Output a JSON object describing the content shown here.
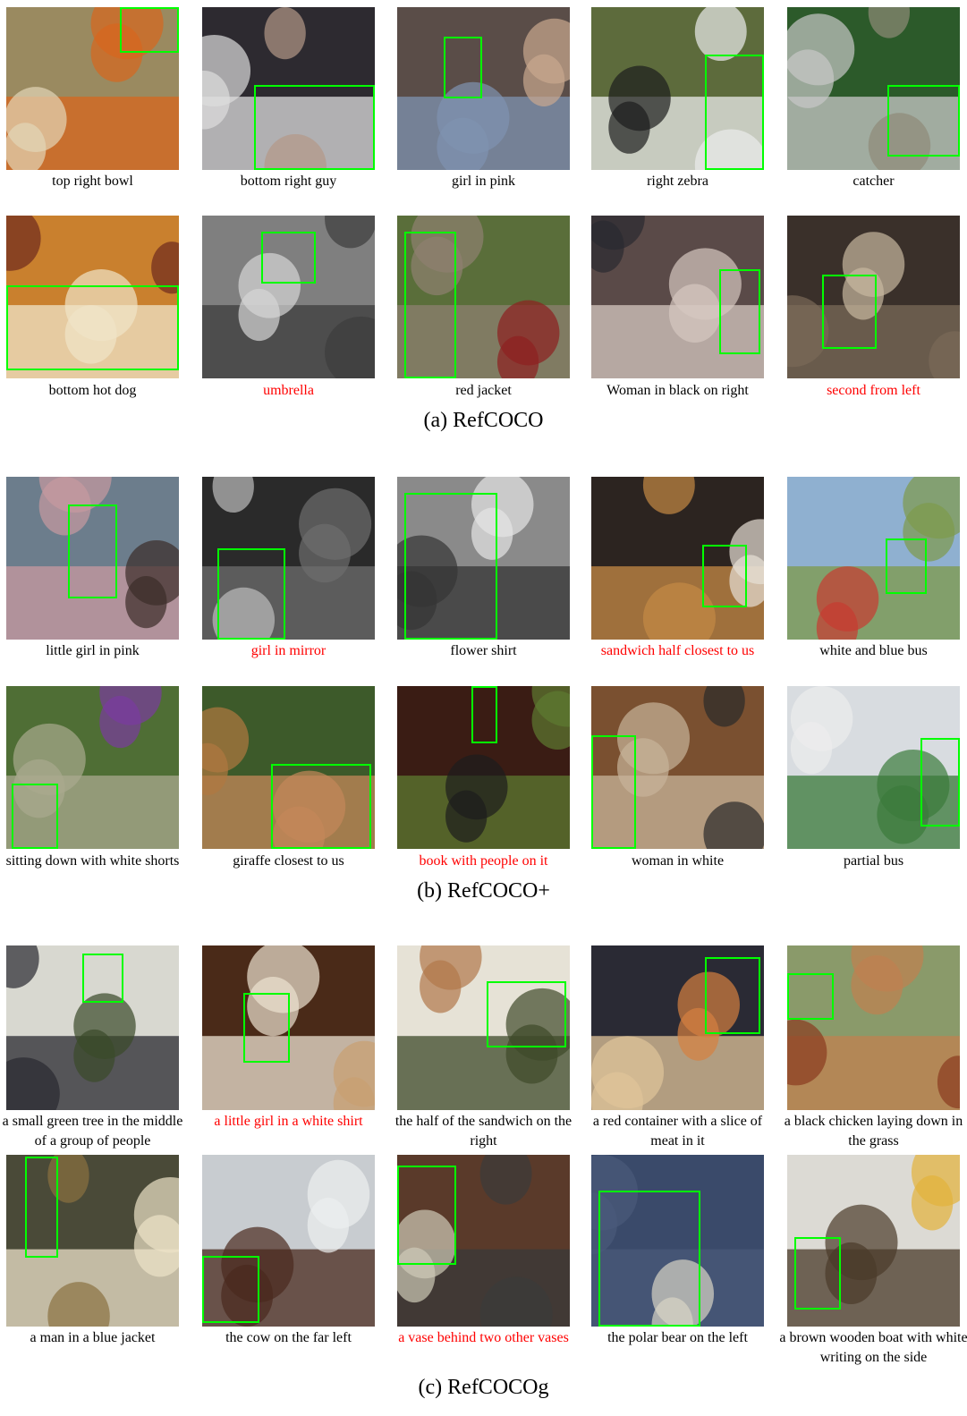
{
  "sections": [
    {
      "title": "(a) RefCOCO",
      "items": [
        {
          "caption": "top right bowl",
          "red": false,
          "palette": [
            "#9a8a60",
            "#e3d6b8",
            "#d7661e"
          ],
          "box": {
            "l": 0.66,
            "t": 0.0,
            "w": 0.34,
            "h": 0.28
          }
        },
        {
          "caption": "bottom right guy",
          "red": false,
          "palette": [
            "#2d2a30",
            "#b49888",
            "#dddddd"
          ],
          "box": {
            "l": 0.3,
            "t": 0.48,
            "w": 0.7,
            "h": 0.52
          }
        },
        {
          "caption": "girl in pink",
          "red": false,
          "palette": [
            "#5a4d48",
            "#c9a88f",
            "#7f93b0"
          ],
          "box": {
            "l": 0.27,
            "t": 0.18,
            "w": 0.22,
            "h": 0.38
          }
        },
        {
          "caption": "right zebra",
          "red": false,
          "palette": [
            "#5d6b3c",
            "#1c1c1c",
            "#ebebeb"
          ],
          "box": {
            "l": 0.66,
            "t": 0.29,
            "w": 0.34,
            "h": 0.71
          }
        },
        {
          "caption": "catcher",
          "red": false,
          "palette": [
            "#2c5a2a",
            "#8e8a78",
            "#c8c8c8"
          ],
          "box": {
            "l": 0.58,
            "t": 0.48,
            "w": 0.42,
            "h": 0.44
          }
        },
        {
          "caption": "bottom hot dog",
          "red": false,
          "palette": [
            "#c9802e",
            "#6d2a1e",
            "#efe4c8"
          ],
          "box": {
            "l": 0.0,
            "t": 0.43,
            "w": 1.0,
            "h": 0.52
          }
        },
        {
          "caption": "umbrella",
          "red": true,
          "palette": [
            "#7f7f7f",
            "#d6d6d6",
            "#3c3c3c"
          ],
          "box": {
            "l": 0.34,
            "t": 0.1,
            "w": 0.32,
            "h": 0.32
          }
        },
        {
          "caption": "red jacket",
          "red": false,
          "palette": [
            "#5a6e3a",
            "#8d1f1f",
            "#8e8070"
          ],
          "box": {
            "l": 0.04,
            "t": 0.1,
            "w": 0.3,
            "h": 0.9
          }
        },
        {
          "caption": "Woman in black on right",
          "red": false,
          "palette": [
            "#5a4a48",
            "#2a2a30",
            "#d6c8c0"
          ],
          "box": {
            "l": 0.74,
            "t": 0.33,
            "w": 0.24,
            "h": 0.52
          }
        },
        {
          "caption": "second from left",
          "red": true,
          "palette": [
            "#3a302a",
            "#c8b8a0",
            "#7a6a58"
          ],
          "box": {
            "l": 0.2,
            "t": 0.36,
            "w": 0.32,
            "h": 0.46
          }
        }
      ]
    },
    {
      "title": "(b) RefCOCO+",
      "items": [
        {
          "caption": "little girl in pink",
          "red": false,
          "palette": [
            "#6c7d8c",
            "#3a2c28",
            "#c89aa0"
          ],
          "box": {
            "l": 0.36,
            "t": 0.17,
            "w": 0.28,
            "h": 0.58
          }
        },
        {
          "caption": "girl in mirror",
          "red": true,
          "palette": [
            "#2a2a2a",
            "#bdbdbd",
            "#6e6e6e"
          ],
          "box": {
            "l": 0.09,
            "t": 0.44,
            "w": 0.39,
            "h": 0.56
          }
        },
        {
          "caption": "flower shirt",
          "red": false,
          "palette": [
            "#8a8a8a",
            "#e6e6e6",
            "#343434"
          ],
          "box": {
            "l": 0.04,
            "t": 0.1,
            "w": 0.54,
            "h": 0.9
          }
        },
        {
          "caption": "sandwich half closest to us",
          "red": true,
          "palette": [
            "#2c2420",
            "#e7e0d6",
            "#c58a45"
          ],
          "box": {
            "l": 0.64,
            "t": 0.42,
            "w": 0.26,
            "h": 0.38
          }
        },
        {
          "caption": "white and blue bus",
          "red": false,
          "palette": [
            "#8fb0d0",
            "#c83a30",
            "#7e9a4a"
          ],
          "box": {
            "l": 0.57,
            "t": 0.38,
            "w": 0.24,
            "h": 0.34
          }
        },
        {
          "caption": "sitting down with white shorts",
          "red": false,
          "palette": [
            "#4f6e35",
            "#7b3aa0",
            "#a9a98f"
          ],
          "box": {
            "l": 0.03,
            "t": 0.6,
            "w": 0.27,
            "h": 0.4
          }
        },
        {
          "caption": "giraffe closest to us",
          "red": false,
          "palette": [
            "#3d5a2a",
            "#b07840",
            "#c4885a"
          ],
          "box": {
            "l": 0.4,
            "t": 0.48,
            "w": 0.58,
            "h": 0.52
          }
        },
        {
          "caption": "book with people on it",
          "red": true,
          "palette": [
            "#3a1c14",
            "#1c1c1c",
            "#5e7a30"
          ],
          "box": {
            "l": 0.43,
            "t": 0.0,
            "w": 0.15,
            "h": 0.35
          }
        },
        {
          "caption": "woman in white",
          "red": false,
          "palette": [
            "#7a5030",
            "#2a2a2a",
            "#c8b49a"
          ],
          "box": {
            "l": 0.0,
            "t": 0.3,
            "w": 0.26,
            "h": 0.7
          }
        },
        {
          "caption": "partial bus",
          "red": false,
          "palette": [
            "#d8dce0",
            "#ececec",
            "#3a7a3a"
          ],
          "box": {
            "l": 0.77,
            "t": 0.32,
            "w": 0.23,
            "h": 0.54
          }
        }
      ]
    },
    {
      "title": "(c) RefCOCOg",
      "items": [
        {
          "caption": "a small green tree in the middle of a group of people",
          "red": false,
          "palette": [
            "#d8d8d0",
            "#3a4a2a",
            "#2a2a30"
          ],
          "box": {
            "l": 0.44,
            "t": 0.05,
            "w": 0.24,
            "h": 0.3
          }
        },
        {
          "caption": "a little girl in a white shirt",
          "red": true,
          "palette": [
            "#4a2a18",
            "#c9a070",
            "#ece2d0"
          ],
          "box": {
            "l": 0.24,
            "t": 0.29,
            "w": 0.27,
            "h": 0.42
          }
        },
        {
          "caption": "the half of the sandwich on the right",
          "red": false,
          "palette": [
            "#e6e2d6",
            "#b0784a",
            "#3e4a2a"
          ],
          "box": {
            "l": 0.52,
            "t": 0.22,
            "w": 0.46,
            "h": 0.4
          }
        },
        {
          "caption": "a red container with a slice of meat in it",
          "red": false,
          "palette": [
            "#2a2a34",
            "#d68040",
            "#e0c49a"
          ],
          "box": {
            "l": 0.66,
            "t": 0.07,
            "w": 0.32,
            "h": 0.47
          }
        },
        {
          "caption": "a black chicken laying down in the grass",
          "red": false,
          "palette": [
            "#8a9a6a",
            "#8a3a20",
            "#c08050"
          ],
          "box": {
            "l": 0.0,
            "t": 0.17,
            "w": 0.27,
            "h": 0.28
          }
        },
        {
          "caption": "a man in a blue jacket",
          "red": false,
          "palette": [
            "#4a4a38",
            "#8a7040",
            "#ece2c8"
          ],
          "box": {
            "l": 0.11,
            "t": 0.01,
            "w": 0.19,
            "h": 0.59
          }
        },
        {
          "caption": "the cow on the far left",
          "red": false,
          "palette": [
            "#c8ccd0",
            "#ecefef",
            "#4a2a1e"
          ],
          "box": {
            "l": 0.0,
            "t": 0.59,
            "w": 0.33,
            "h": 0.39
          }
        },
        {
          "caption": "a vase behind two other vases",
          "red": true,
          "palette": [
            "#5a3a2a",
            "#cfcab8",
            "#3a3a3a"
          ],
          "box": {
            "l": 0.0,
            "t": 0.06,
            "w": 0.34,
            "h": 0.58
          }
        },
        {
          "caption": "the polar bear on the left",
          "red": false,
          "palette": [
            "#3a4a6a",
            "#d8d4c4",
            "#4a5a7a"
          ],
          "box": {
            "l": 0.04,
            "t": 0.21,
            "w": 0.59,
            "h": 0.79
          }
        },
        {
          "caption": "a brown wooden boat with white writing on the side",
          "red": false,
          "palette": [
            "#dcdad4",
            "#e3b23a",
            "#4a3a2a"
          ],
          "box": {
            "l": 0.04,
            "t": 0.48,
            "w": 0.27,
            "h": 0.42
          }
        }
      ]
    }
  ]
}
